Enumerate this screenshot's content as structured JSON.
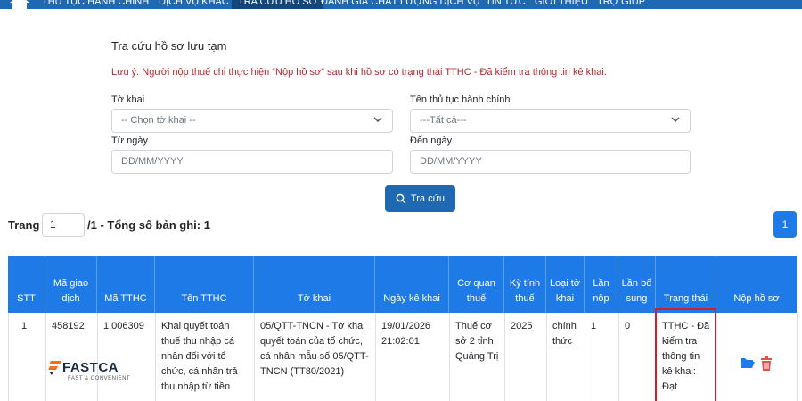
{
  "nav": {
    "items": [
      {
        "label": "Thủ tục hành chính",
        "active": false
      },
      {
        "label": "Dịch vụ khác",
        "active": false
      },
      {
        "label": "Tra cứu hồ sơ",
        "active": true
      },
      {
        "label": "Đánh giá chất lượng dịch vụ",
        "active": false
      },
      {
        "label": "Tin tức",
        "active": false
      },
      {
        "label": "Giới thiệu",
        "active": false
      },
      {
        "label": "Trợ giúp",
        "active": false
      }
    ],
    "bg_color": "#1f69b3",
    "active_color": "#13467a"
  },
  "search": {
    "title": "Tra cứu hồ sơ lưu tạm",
    "notice": "Lưu ý: Người nộp thuế chỉ thực hiện “Nộp hồ sơ” sau khi hồ sơ có trạng thái TTHC - Đã kiểm tra thông tin kê khai.",
    "to_khai_label": "Tờ khai",
    "to_khai_value": "-- Chọn tờ khai --",
    "thu_tuc_label": "Tên thủ tục hành chính",
    "thu_tuc_value": "---Tất cả---",
    "tu_ngay_label": "Từ ngày",
    "tu_ngay_placeholder": "DD/MM/YYYY",
    "den_ngay_label": "Đến ngày",
    "den_ngay_placeholder": "DD/MM/YYYY",
    "button_label": "Tra cứu"
  },
  "pagination": {
    "page_label": "Trang",
    "page_value": "1",
    "total_text": "/1 - Tổng số bản ghi: 1",
    "page_button": "1"
  },
  "table": {
    "headers": [
      "STT",
      "Mã giao dịch",
      "Mã TTHC",
      "Tên TTHC",
      "Tờ khai",
      "Ngày kê khai",
      "Cơ quan thuế",
      "Kỳ tính thuế",
      "Loại tờ khai",
      "Lần nộp",
      "Lần bổ sung",
      "Trạng thái",
      "Nộp hồ sơ"
    ],
    "rows": [
      {
        "stt": "1",
        "ma_giao_dich": "458192",
        "ma_tthc": "1.006309",
        "ten_tthc": "Khai quyết toán thuế thu nhập cá nhân đối với tổ chức, cá nhân trả thu nhập từ tiền",
        "to_khai": "05/QTT-TNCN - Tờ khai quyết toán của tổ chức, cá nhân mẫu số 05/QTT-TNCN (TT80/2021)",
        "ngay_ke_khai": "19/01/2026 21:02:01",
        "co_quan_thue": "Thuế cơ sở 2 tỉnh Quảng Trị",
        "ky_tinh_thue": "2025",
        "loai_to_khai": "chính thức",
        "lan_nop": "1",
        "lan_bo_sung": "0",
        "trang_thai": "TTHC - Đã kiểm tra thông tin kê khai: Đạt"
      }
    ],
    "header_color": "#1e7ae6",
    "highlight_color": "#d0202a"
  },
  "logo": {
    "text": "FASTCA",
    "tagline": "FAST & CONVENIENT"
  }
}
